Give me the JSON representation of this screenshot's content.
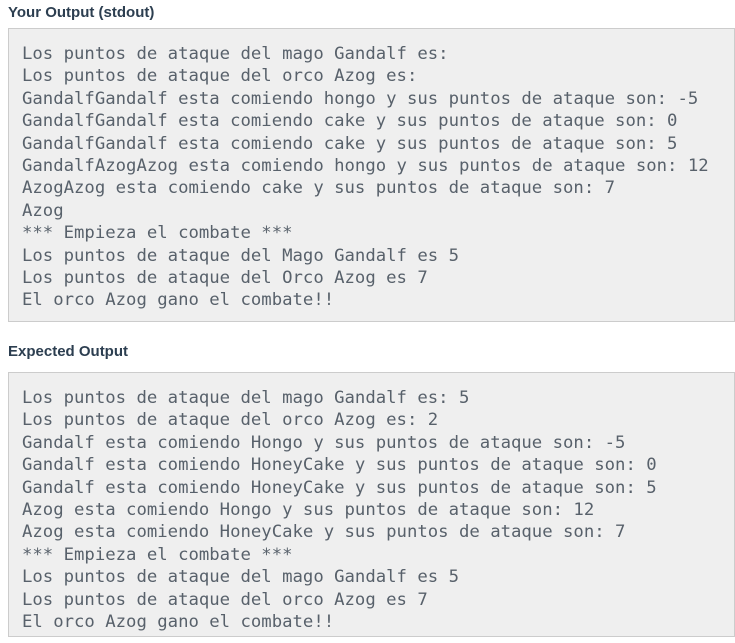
{
  "sections": {
    "stdout": {
      "title": "Your Output (stdout)",
      "lines": [
        "Los puntos de ataque del mago Gandalf es:",
        "Los puntos de ataque del orco Azog es:",
        "GandalfGandalf esta comiendo hongo y sus puntos de ataque son: -5",
        "GandalfGandalf esta comiendo cake y sus puntos de ataque son: 0",
        "GandalfGandalf esta comiendo cake y sus puntos de ataque son: 5",
        "GandalfAzogAzog esta comiendo hongo y sus puntos de ataque son: 12",
        "AzogAzog esta comiendo cake y sus puntos de ataque son: 7",
        "Azog",
        "*** Empieza el combate ***",
        "Los puntos de ataque del Mago Gandalf es 5",
        "Los puntos de ataque del Orco Azog es 7",
        "El orco Azog gano el combate!!"
      ]
    },
    "expected": {
      "title": "Expected Output",
      "lines": [
        "Los puntos de ataque del mago Gandalf es: 5",
        "Los puntos de ataque del orco Azog es: 2",
        "Gandalf esta comiendo Hongo y sus puntos de ataque son: -5",
        "Gandalf esta comiendo HoneyCake y sus puntos de ataque son: 0",
        "Gandalf esta comiendo HoneyCake y sus puntos de ataque son: 5",
        "Azog esta comiendo Hongo y sus puntos de ataque son: 12",
        "Azog esta comiendo HoneyCake y sus puntos de ataque son: 7",
        "*** Empieza el combate ***",
        "Los puntos de ataque del mago Gandalf es 5",
        "Los puntos de ataque del orco Azog es 7",
        "El orco Azog gano el combate!!"
      ]
    }
  },
  "colors": {
    "heading": "#2c3e50",
    "panel_background": "#efefef",
    "panel_border": "#cccccc",
    "code_text": "#58616b",
    "page_background": "#ffffff"
  }
}
